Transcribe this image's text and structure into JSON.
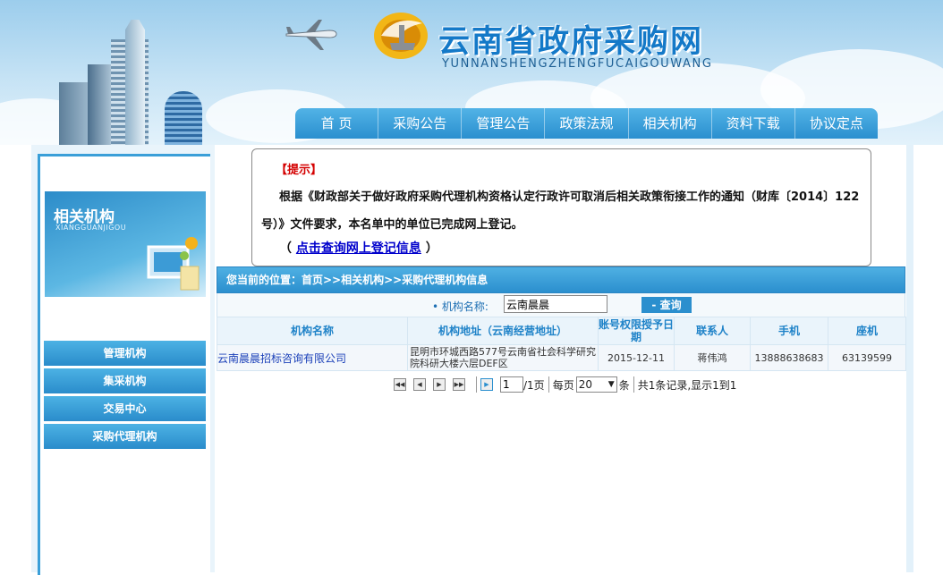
{
  "header": {
    "title": "云南省政府采购网",
    "pinyin": "YUNNANSHENGZHENGFUCAIGOUWANG"
  },
  "nav": [
    "首 页",
    "采购公告",
    "管理公告",
    "政策法规",
    "相关机构",
    "资料下载",
    "协议定点"
  ],
  "sidebar": {
    "banner_title": "相关机构",
    "banner_sub": "XIANGGUANJIGOU",
    "items": [
      "管理机构",
      "集采机构",
      "交易中心",
      "采购代理机构"
    ]
  },
  "notice": {
    "tag": "【提示】",
    "body": "根据《财政部关于做好政府采购代理机构资格认定行政许可取消后相关政策衔接工作的通知（财库〔2014〕122号）》文件要求，本名单中的单位已完成网上登记。",
    "link_prefix": "（",
    "link_text": "点击查询网上登记信息",
    "link_suffix": "）"
  },
  "breadcrumb": "您当前的位置：首页>>相关机构>>采购代理机构信息",
  "search": {
    "label": "• 机构名称:",
    "value": "云南晨晨",
    "button": "- 查询"
  },
  "table": {
    "headers": [
      "机构名称",
      "机构地址（云南经营地址）",
      "账号权限授予日期",
      "联系人",
      "手机",
      "座机"
    ],
    "rows": [
      {
        "name": "云南晨晨招标咨询有限公司",
        "address": "昆明市环城西路577号云南省社会科学研究院科研大楼六层DEF区",
        "date": "2015-12-11",
        "contact": "蒋伟鸿",
        "mobile": "13888638683",
        "phone": "63139599"
      }
    ]
  },
  "pager": {
    "page": "1",
    "total_pages": "/1页",
    "per_page_label": "每页",
    "per_page": "20",
    "unit": "条",
    "summary": "共1条记录,显示1到1"
  },
  "colors": {
    "accent": "#2b8fce",
    "title": "#1479c8",
    "notice_tag": "#d40000",
    "link": "#0000cc"
  }
}
